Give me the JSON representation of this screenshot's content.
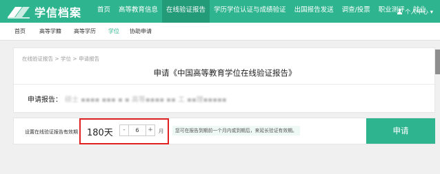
{
  "brand": {
    "name": "学信档案",
    "color": "#2eb58f"
  },
  "nav": {
    "items": [
      {
        "label": "首页"
      },
      {
        "label": "高等教育信息"
      },
      {
        "label": "在线验证报告",
        "active": true
      },
      {
        "label": "学历学位认证与成绩验证"
      },
      {
        "label": "出国报告发送"
      },
      {
        "label": "调查/投票"
      },
      {
        "label": "职业测评"
      },
      {
        "label": "就业"
      }
    ],
    "user_label": "个人中心 ▾",
    "user_icon": "user-icon"
  },
  "subnav": {
    "items": [
      {
        "label": "首页"
      },
      {
        "label": "高等学籍"
      },
      {
        "label": "高等学历"
      },
      {
        "label": "学位",
        "active": true
      },
      {
        "label": "协助申请"
      }
    ]
  },
  "breadcrumb": "在线验证报告 > 学位 > 申请报告",
  "page_title": "申请《中国高等教育学位在线验证报告》",
  "report": {
    "label": "申请报告：",
    "value": "硕士 ▪▪▪▪ ▪▪▪ ▪ ▪ 高等▪▪▪▪  ▪▪ 工 ▪▪理▪▪▪▪▪"
  },
  "validity": {
    "label": "设置在线验证报告有效期",
    "days_text": "180天",
    "minus_label": "-",
    "months_value": "6",
    "plus_label": "+",
    "unit": "月",
    "hint": "您可在报告到期前一个月内或到期后，来延长验证有效期。"
  },
  "apply_button": "申请",
  "highlight_color": "#e02020"
}
